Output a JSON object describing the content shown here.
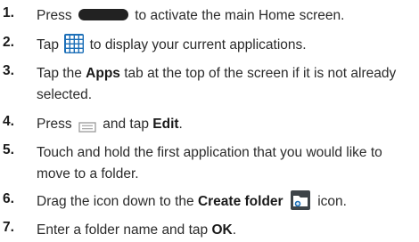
{
  "steps": [
    {
      "num": "1.",
      "parts": [
        {
          "t": "text",
          "v": "Press "
        },
        {
          "t": "icon",
          "v": "home-button"
        },
        {
          "t": "text",
          "v": " to activate the main Home screen."
        }
      ]
    },
    {
      "num": "2.",
      "parts": [
        {
          "t": "text",
          "v": "Tap "
        },
        {
          "t": "icon",
          "v": "apps-grid"
        },
        {
          "t": "text",
          "v": " to display your current applications."
        }
      ]
    },
    {
      "num": "3.",
      "parts": [
        {
          "t": "text",
          "v": "Tap the "
        },
        {
          "t": "bold",
          "v": "Apps"
        },
        {
          "t": "text",
          "v": " tab at the top of the screen if it is not already selected."
        }
      ]
    },
    {
      "num": "4.",
      "parts": [
        {
          "t": "text",
          "v": "Press "
        },
        {
          "t": "icon",
          "v": "menu-key"
        },
        {
          "t": "text",
          "v": " and tap "
        },
        {
          "t": "bold",
          "v": "Edit"
        },
        {
          "t": "text",
          "v": "."
        }
      ]
    },
    {
      "num": "5.",
      "parts": [
        {
          "t": "text",
          "v": "Touch and hold the first application that you would like to move to a folder."
        }
      ]
    },
    {
      "num": "6.",
      "parts": [
        {
          "t": "text",
          "v": "Drag the icon down to the "
        },
        {
          "t": "bold",
          "v": "Create folder"
        },
        {
          "t": "text",
          "v": " "
        },
        {
          "t": "icon",
          "v": "create-folder"
        },
        {
          "t": "text",
          "v": " icon."
        }
      ]
    },
    {
      "num": "7.",
      "parts": [
        {
          "t": "text",
          "v": "Enter a folder name and tap "
        },
        {
          "t": "bold",
          "v": "OK"
        },
        {
          "t": "text",
          "v": "."
        }
      ]
    }
  ],
  "colors": {
    "accent_blue": "#1c6fb8",
    "text": "#2b2b2b"
  }
}
